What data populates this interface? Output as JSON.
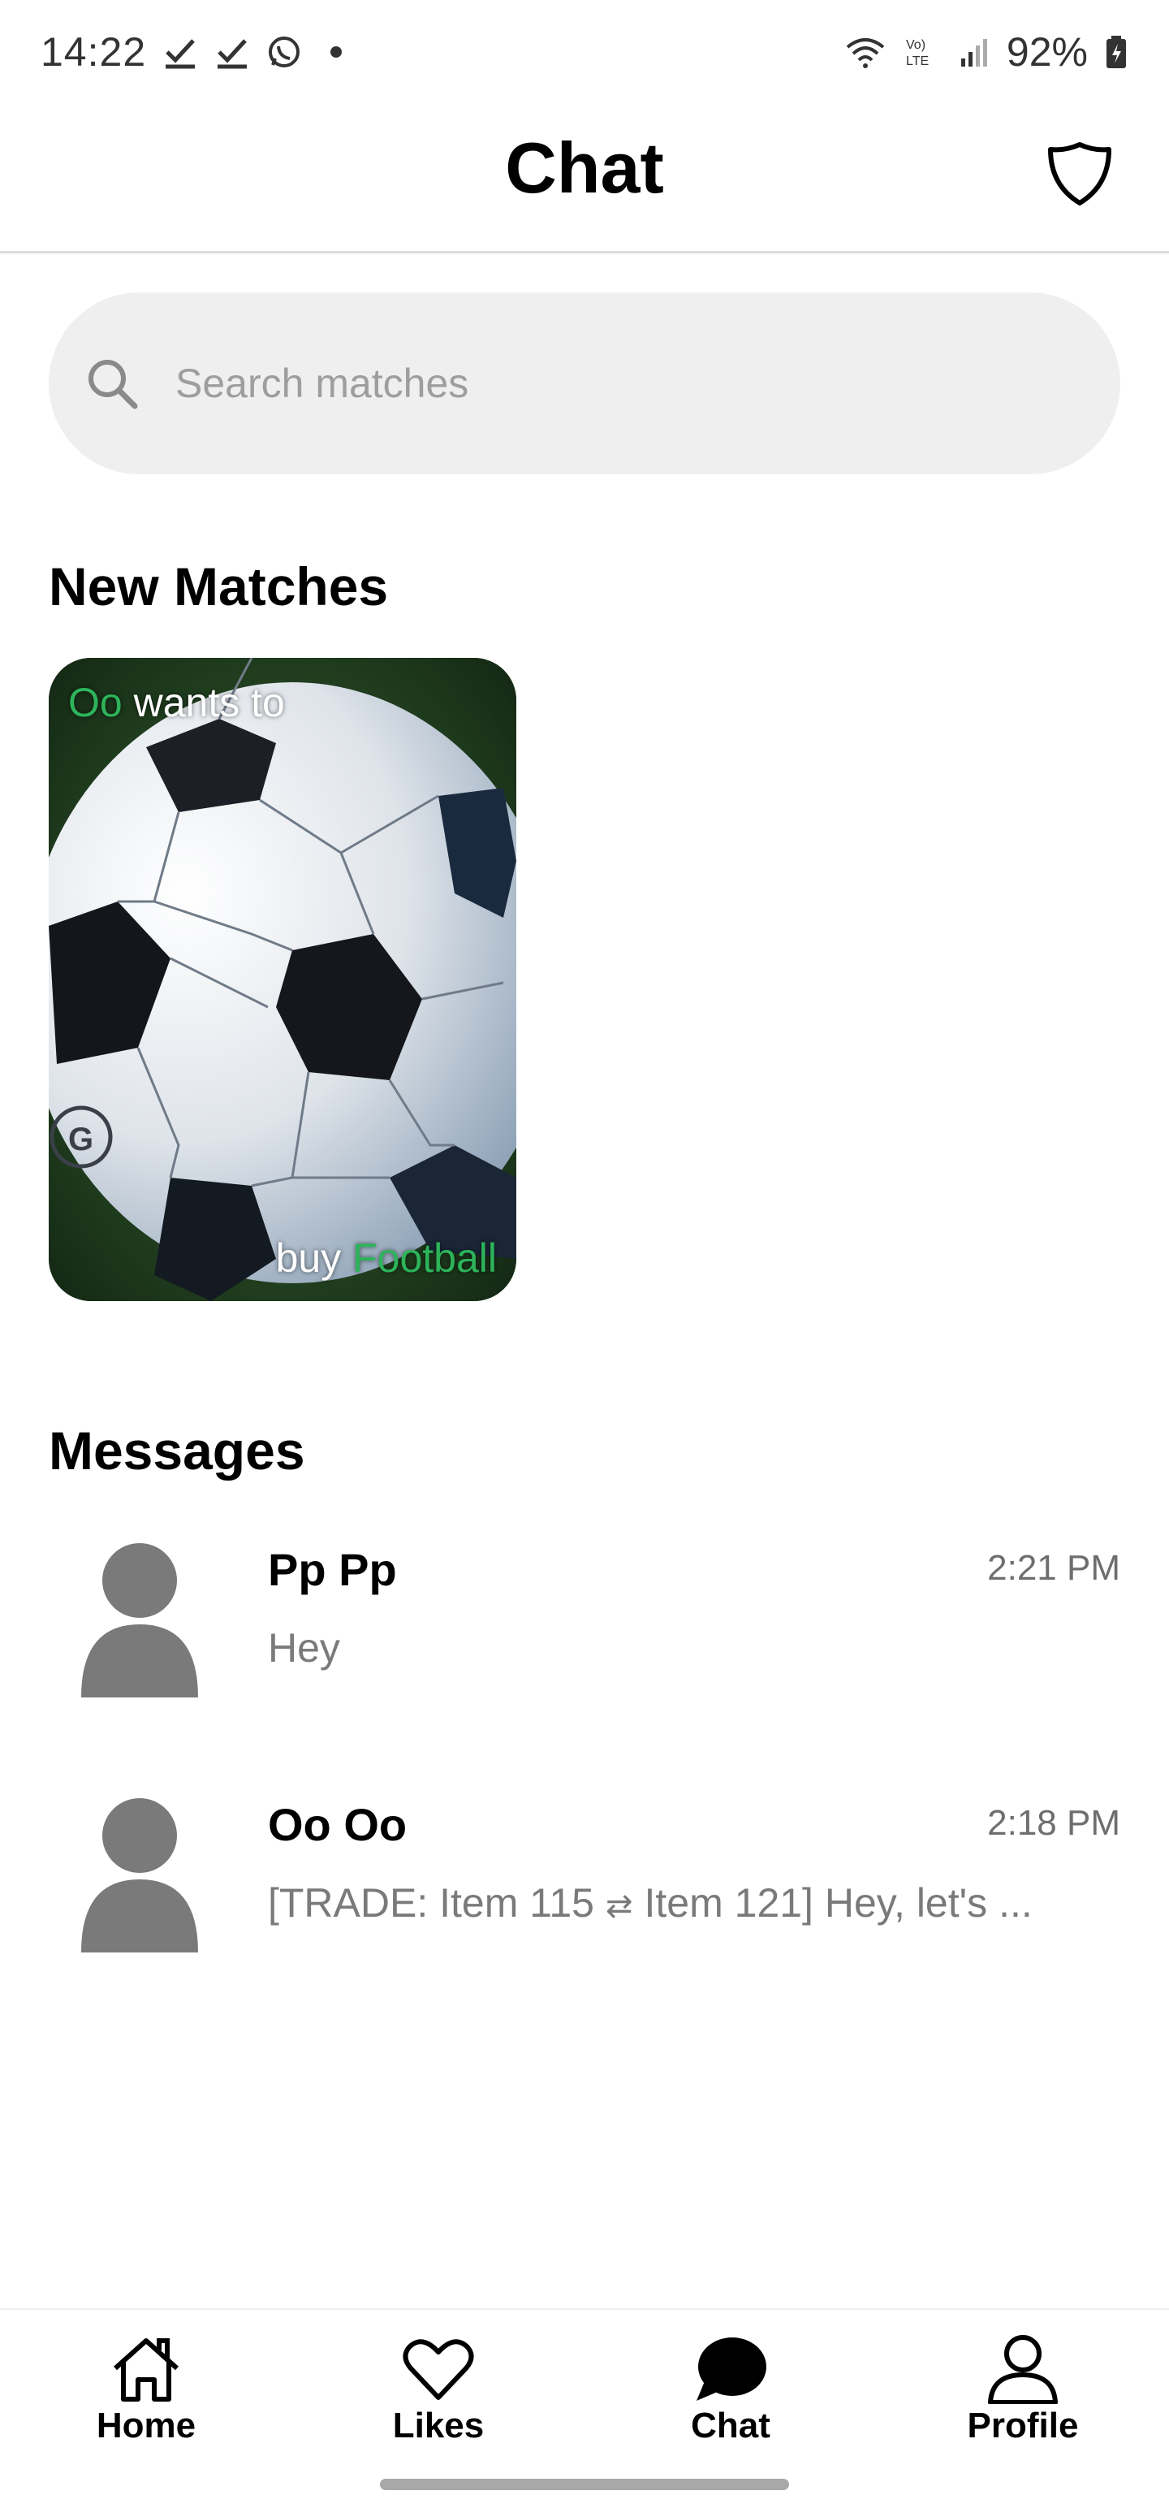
{
  "status_bar": {
    "time": "14:22",
    "battery": "92%",
    "left_icons": [
      "check-icon",
      "check-icon",
      "whatsapp-icon",
      "dot-icon"
    ],
    "right_icons": [
      "wifi-icon",
      "volte-icon",
      "signal-icon",
      "battery-charging-icon"
    ]
  },
  "header": {
    "title": "Chat",
    "right_icon": "shield-icon"
  },
  "search": {
    "placeholder": "Search matches",
    "icon": "search-icon"
  },
  "new_matches": {
    "heading": "New Matches",
    "cards": [
      {
        "user": "Oo",
        "top_text": " wants  to",
        "bottom_text": "buy ",
        "item": "Football",
        "image": "soccer-ball-photo"
      }
    ]
  },
  "messages": {
    "heading": "Messages",
    "items": [
      {
        "name": "Pp Pp",
        "time": "2:21 PM",
        "preview": "Hey",
        "avatar": "person-avatar-icon"
      },
      {
        "name": "Oo Oo",
        "time": "2:18 PM",
        "preview_start": "[TRADE: Item 115",
        "preview_swap": "⇄",
        "preview_end": "Item 121] Hey, let's ...",
        "avatar": "person-avatar-icon"
      }
    ]
  },
  "bottom_nav": {
    "items": [
      {
        "label": "Home",
        "icon": "home-icon",
        "active": false
      },
      {
        "label": "Likes",
        "icon": "heart-icon",
        "active": false
      },
      {
        "label": "Chat",
        "icon": "chat-bubble-icon",
        "active": true
      },
      {
        "label": "Profile",
        "icon": "person-icon",
        "active": false
      }
    ]
  },
  "colors": {
    "accent_green": "#2db45a",
    "search_bg": "#efefef",
    "avatar_gray": "#7a7a7a",
    "muted_text": "#7a7a7a"
  }
}
